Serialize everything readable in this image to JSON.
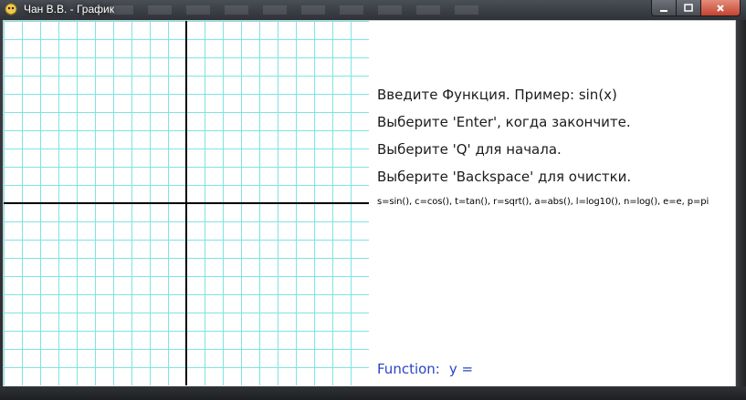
{
  "window": {
    "title": "Чан В.В. - График",
    "icon": "pygame-snake-icon",
    "controls": {
      "minimize": "minimize-icon",
      "maximize": "maximize-icon",
      "close": "close-icon"
    }
  },
  "graph": {
    "grid_color": "#7fe3e3",
    "axis_color": "#000000",
    "background": "#ffffff"
  },
  "instructions": {
    "line1": "Введите Функция. Пример: sin(x)",
    "line2": "Выберите 'Enter', когда закончите.",
    "line3": "Выберите 'Q' для начала.",
    "line4": "Выберите 'Backspace' для очистки.",
    "hint": "s=sin(), c=cos(), t=tan(), r=sqrt(), a=abs(), l=log10(), n=log(), e=e, p=pi"
  },
  "input": {
    "label": "Function:",
    "prompt": "y =",
    "color": "#2a44c8"
  }
}
